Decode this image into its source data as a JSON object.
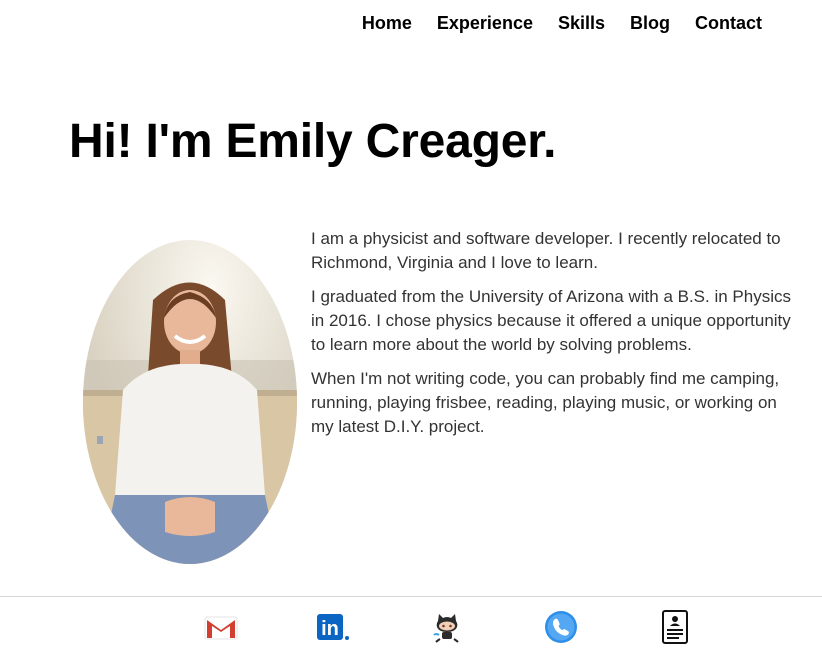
{
  "nav": {
    "items": [
      {
        "label": "Home"
      },
      {
        "label": "Experience"
      },
      {
        "label": "Skills"
      },
      {
        "label": "Blog"
      },
      {
        "label": "Contact"
      }
    ]
  },
  "hero": {
    "headline": "Hi! I'm Emily Creager."
  },
  "bio": {
    "paragraphs": [
      "I am a physicist and software developer. I recently relocated to Richmond, Virginia and I love to learn.",
      "I graduated from the University of Arizona with a B.S. in Physics in 2016. I chose physics because it offered a unique opportunity to learn more about the world by solving problems.",
      "When I'm not writing code, you can probably find me camping, running, playing frisbee, reading, playing music, or working on my latest D.I.Y. project."
    ]
  },
  "footer": {
    "icons": [
      {
        "name": "gmail-icon"
      },
      {
        "name": "linkedin-icon",
        "label": "in"
      },
      {
        "name": "github-octocat-icon"
      },
      {
        "name": "phone-icon"
      },
      {
        "name": "resume-icon"
      }
    ]
  },
  "colors": {
    "gmail_red": "#d23f31",
    "linkedin_blue": "#0a66c2",
    "phone_blue": "#2d8fe8"
  }
}
